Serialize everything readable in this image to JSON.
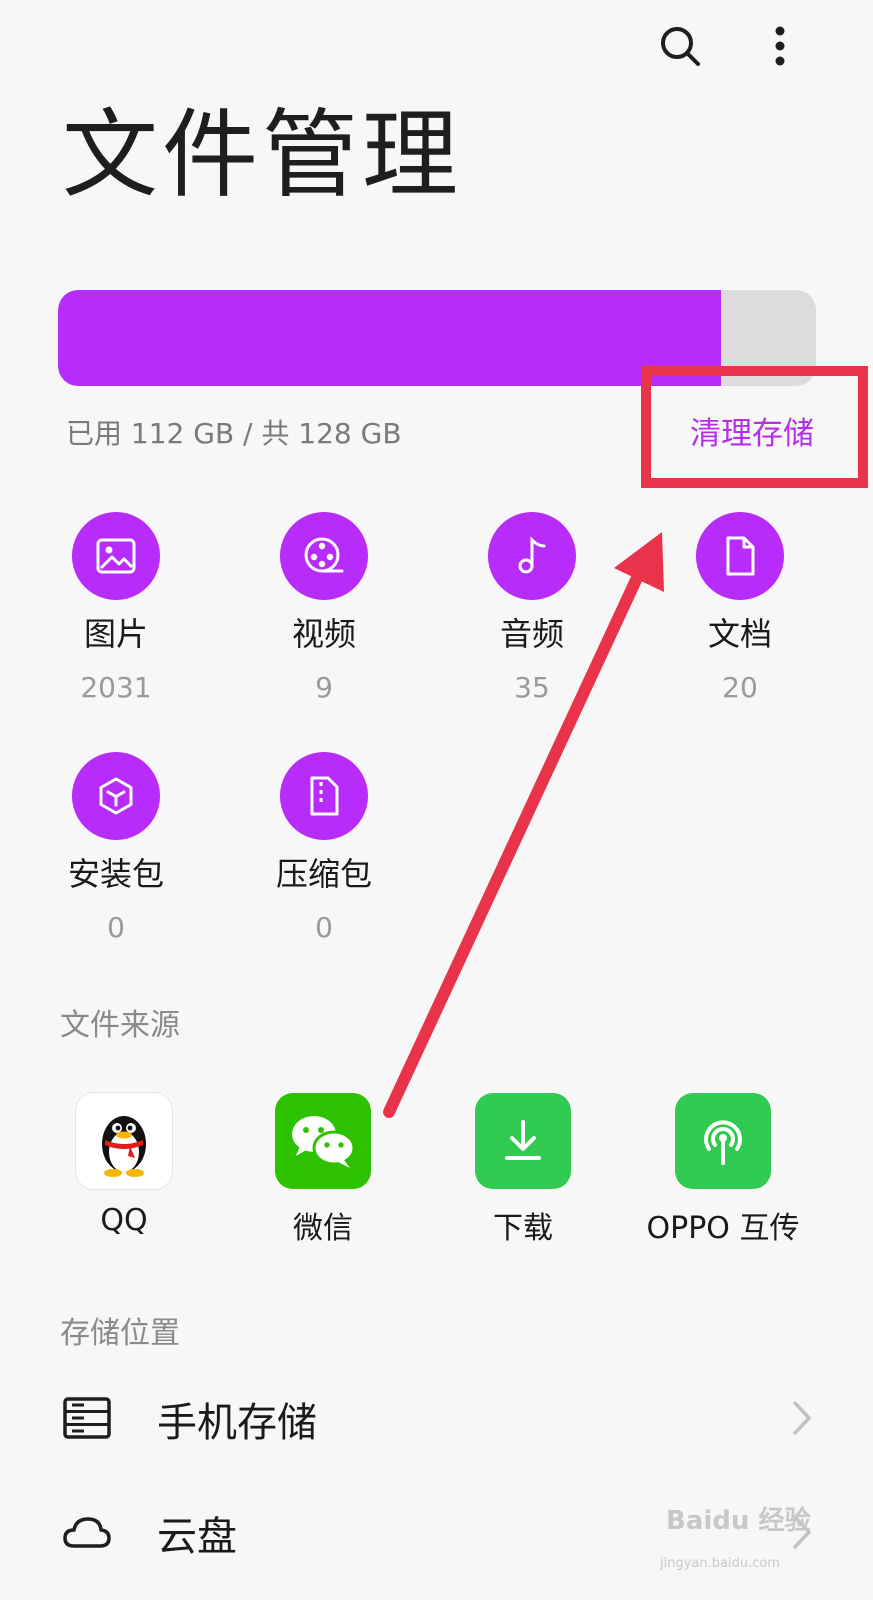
{
  "header": {
    "title": "文件管理",
    "search_icon": "search-icon",
    "more_icon": "more-vertical-icon"
  },
  "storage": {
    "used_text": "已用 112 GB / 共 128 GB",
    "used_fraction": 0.875,
    "clean_label": "清理存储",
    "fill_color": "#b72cfa",
    "empty_color": "#dcdcdc",
    "accent_text_color": "#b62ee8"
  },
  "categories": [
    {
      "label": "图片",
      "count": "2031",
      "icon": "image-icon"
    },
    {
      "label": "视频",
      "count": "9",
      "icon": "video-reel-icon"
    },
    {
      "label": "音频",
      "count": "35",
      "icon": "music-note-icon"
    },
    {
      "label": "文档",
      "count": "20",
      "icon": "document-icon"
    },
    {
      "label": "安装包",
      "count": "0",
      "icon": "package-cube-icon"
    },
    {
      "label": "压缩包",
      "count": "0",
      "icon": "zip-file-icon"
    }
  ],
  "sources": {
    "title": "文件来源",
    "items": [
      {
        "label": "QQ",
        "icon": "qq-penguin-icon"
      },
      {
        "label": "微信",
        "icon": "wechat-icon"
      },
      {
        "label": "下载",
        "icon": "download-icon"
      },
      {
        "label": "OPPO 互传",
        "icon": "oppo-share-icon"
      }
    ]
  },
  "locations": {
    "title": "存储位置",
    "items": [
      {
        "label": "手机存储",
        "icon": "phone-storage-icon"
      },
      {
        "label": "云盘",
        "icon": "cloud-icon"
      }
    ]
  },
  "watermark": {
    "brand": "Baidu 经验",
    "url": "jingyan.baidu.com"
  },
  "colors": {
    "category_circle": "#b72cfa",
    "highlight_red": "#e8334a",
    "wechat_green": "#2dc100",
    "green_tile": "#2fca4f"
  }
}
